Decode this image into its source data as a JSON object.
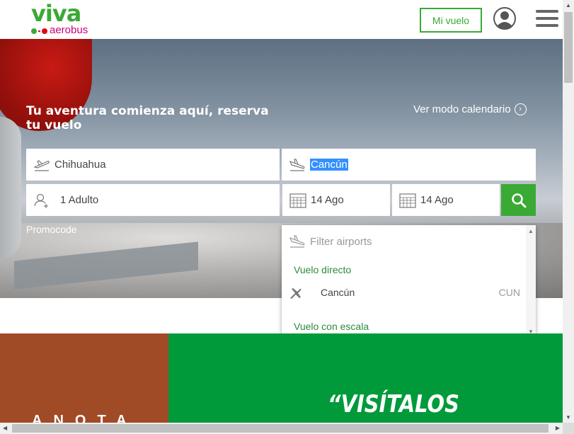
{
  "header": {
    "logo_text": "viva",
    "logo_sub": "aerobus",
    "mi_vuelo": "Mi vuelo",
    "user_icon": "user-circle-icon",
    "menu_icon": "hamburger-menu-icon"
  },
  "hero": {
    "title": "Tu aventura comienza aquí, reserva tu vuelo",
    "calendar_link": "Ver modo calendario",
    "calendar_icon": "chevron-right-circle-icon"
  },
  "form": {
    "origin": "Chihuahua",
    "destination": "Cancún",
    "passengers": "1 Adulto",
    "date_depart": "14 Ago",
    "date_return": "14 Ago",
    "promocode": "Promocode"
  },
  "dropdown": {
    "placeholder": "Filter airports",
    "group_direct": "Vuelo directo",
    "items": [
      {
        "name": "Cancún",
        "code": "CUN"
      }
    ],
    "group_layover": "Vuelo con escala"
  },
  "banners": {
    "left_text": "ANOTA",
    "right_text": "“VISÍTALOS"
  },
  "colors": {
    "brand_green": "#3aaa35",
    "brand_magenta": "#c6007e",
    "banner_brown": "#a14a26",
    "banner_green": "#009a3a"
  }
}
